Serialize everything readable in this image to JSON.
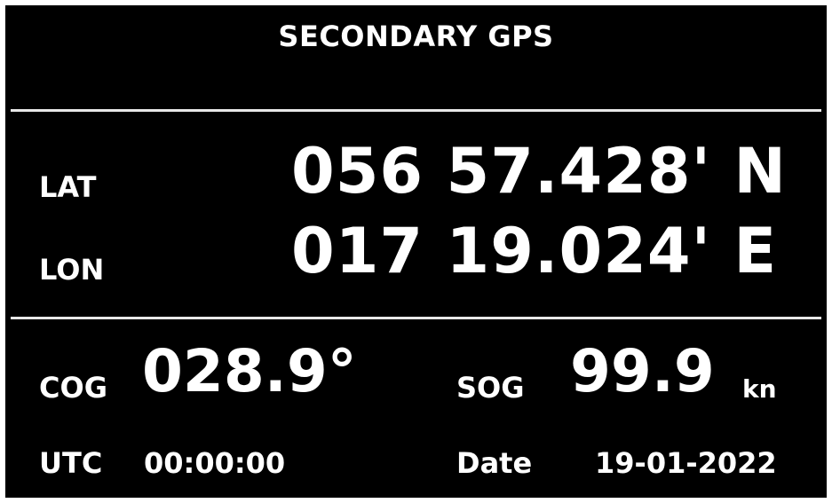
{
  "title": "SECONDARY GPS",
  "position": {
    "lat_label": "LAT",
    "lat_value": "056 57.428' N",
    "lon_label": "LON",
    "lon_value": "017 19.024' E"
  },
  "navigation": {
    "cog_label": "COG",
    "cog_value": "028.9°",
    "sog_label": "SOG",
    "sog_value": "99.9",
    "sog_unit": "kn"
  },
  "time": {
    "utc_label": "UTC",
    "utc_value": "00:00:00",
    "date_label": "Date",
    "date_value": "19-01-2022"
  },
  "colors": {
    "background": "#000000",
    "text": "#ffffff",
    "divider": "#e8e8e8"
  }
}
